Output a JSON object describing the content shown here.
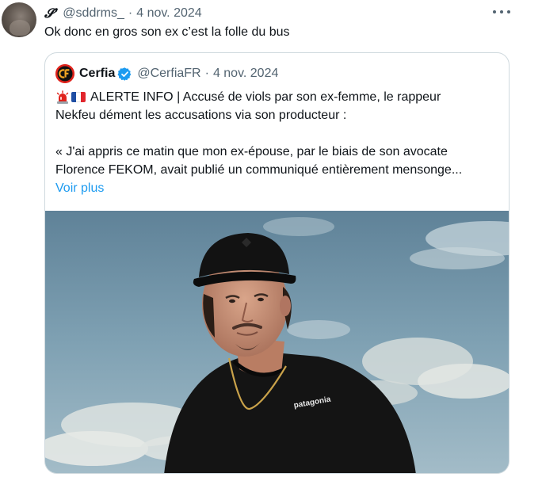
{
  "tweet": {
    "display_name": "𝓢'",
    "handle": "@sddrms_",
    "separator": "·",
    "date": "4 nov. 2024",
    "text": "Ok donc en gros son ex c’est la folle du bus",
    "more_icon": "more-horizontal-icon"
  },
  "quote": {
    "name": "Cerfia",
    "handle": "@CerfiaFR",
    "separator": "·",
    "date": "4 nov. 2024",
    "avatar_text": "CF",
    "verified_color": "#1d9bf0",
    "line1": "ALERTE INFO | Accusé de viols par son ex-femme, le rappeur",
    "line2": "Nekfeu dément les accusations via son producteur :",
    "line3": "« J'ai appris ce matin que mon ex-épouse, par le biais de son avocate",
    "line4": "Florence FEKOM, avait publié un communiqué entièrement mensonge...",
    "show_more": "Voir plus",
    "media_shirt_logo": "patagonia"
  },
  "colors": {
    "link": "#1d9bf0",
    "muted": "#536471",
    "border": "#cfd9de",
    "brand_red": "#e0231c"
  }
}
